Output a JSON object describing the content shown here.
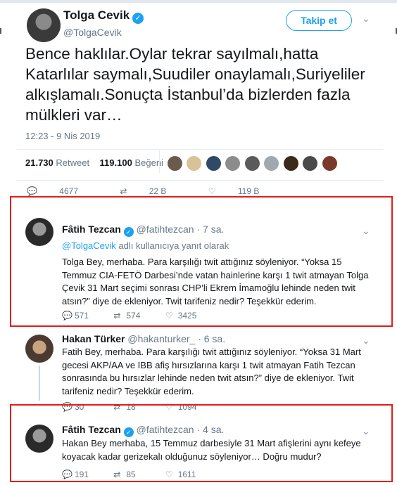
{
  "main": {
    "author_name": "Tolga Cevik",
    "author_handle": "@TolgaCevik",
    "follow_label": "Takip et",
    "text": "Bence haklılar.Oylar tekrar sayılmalı,hatta Katarlılar saymalı,Suudiler onaylamalı,Suriyeliler alkışlamalı.Sonuçta İstanbul’da bizlerden fazla mülkleri var…",
    "timestamp": "12:23 - 9 Nis 2019",
    "retweet_count": "21.730",
    "retweet_label": "Retweet",
    "like_count": "119.100",
    "like_label": "Beğeni",
    "action_replies": "4677",
    "action_retweets": "22 B",
    "action_likes": "119 B"
  },
  "replies": [
    {
      "name": "Fâtih Tezcan",
      "handle": "@fatihtezcan",
      "time": "· 7 sa.",
      "reply_to_handle": "@TolgaCevik",
      "reply_to_suffix": " adlı kullanıcıya yanıt olarak",
      "text": "Tolga Bey, merhaba. Para karşılığı twit attığınız söyleniyor. “Yoksa 15 Temmuz CIA-FETÖ Darbesi’nde vatan hainlerine karşı 1 twit atmayan Tolga Çevik 31 Mart seçimi sonrası CHP’li Ekrem İmamoğlu lehinde neden twit atsın?” diye de ekleniyor. Twit tarifeniz nedir? Teşekkür ederim.",
      "replies": "571",
      "retweets": "574",
      "likes": "3425"
    },
    {
      "name": "Hakan Türker",
      "handle": "@hakanturker_",
      "time": "· 6 sa.",
      "text": "Fatih Bey, merhaba. Para karşılığı twit attığınız söyleniyor. “Yoksa 31 Mart gecesi AKP/AA ve IBB afiş hırsızlarına karşı 1 twit atmayan Fatih Tezcan sonrasında bu hırsızlar lehinde neden twit atsın?” diye de ekleniyor. Twit tarifeniz nedir? Teşekkür ederim.",
      "replies": "30",
      "retweets": "18",
      "likes": "1094"
    },
    {
      "name": "Fâtih Tezcan",
      "handle": "@fatihtezcan",
      "time": "· 4 sa.",
      "text": "Hakan Bey merhaba, 15 Temmuz darbesiyle 31 Mart afişlerini aynı kefeye koyacak kadar gerizekalı olduğunuz söyleniyor… Doğru mudur?",
      "replies": "191",
      "retweets": "85",
      "likes": "1611"
    }
  ],
  "icons": {
    "verified": "✓",
    "chevron": "⌄",
    "reply": "💬",
    "retweet": "⇄",
    "like": "♡"
  },
  "colors": {
    "accent": "#1da1f2",
    "highlight_box": "#e41b1b"
  }
}
